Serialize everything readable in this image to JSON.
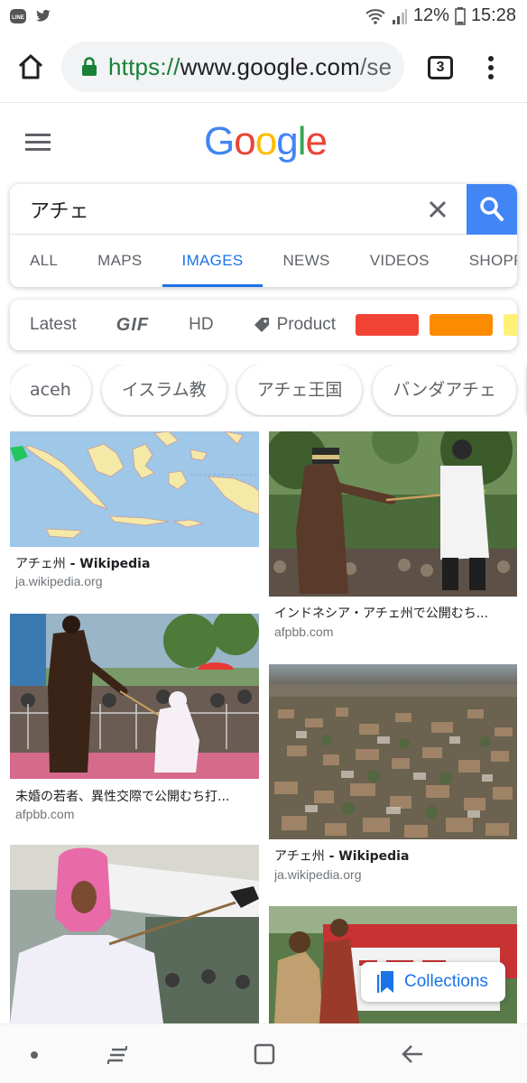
{
  "status_bar": {
    "left_icons": [
      "line-icon",
      "twitter-icon"
    ],
    "right_icons": [
      "wifi-icon",
      "signal-icon",
      "battery-icon"
    ],
    "battery": "12%",
    "time": "15:28"
  },
  "browser": {
    "url_scheme": "https://",
    "url_host": "www.google.com",
    "url_rest": "/se",
    "tab_count": "3",
    "icons": [
      "home-icon",
      "lock-icon",
      "more-vert-icon"
    ]
  },
  "google": {
    "logo": "Google",
    "icons": [
      "menu-icon"
    ]
  },
  "search": {
    "query": "アチェ",
    "icons": [
      "close-icon",
      "search-icon"
    ],
    "tabs": [
      {
        "label": "ALL",
        "active": false
      },
      {
        "label": "MAPS",
        "active": false
      },
      {
        "label": "IMAGES",
        "active": true
      },
      {
        "label": "NEWS",
        "active": false
      },
      {
        "label": "VIDEOS",
        "active": false
      },
      {
        "label": "SHOPPI",
        "active": false
      }
    ]
  },
  "filters": {
    "labels": [
      "Latest",
      "GIF",
      "HD",
      "Product"
    ],
    "icons": [
      "tag-icon"
    ],
    "colors": [
      "#f04336",
      "#fb8c00",
      "#fff176"
    ]
  },
  "chips": [
    "aceh",
    "イスラム教",
    "アチェ王国",
    "バンダアチェ"
  ],
  "results": [
    {
      "title_main": "アチェ州",
      "title_suffix": " - Wikipedia",
      "source": "ja.wikipedia.org"
    },
    {
      "title_main": "インドネシア・アチェ州で公開むち...",
      "title_suffix": "",
      "source": "afpbb.com"
    },
    {
      "title_main": "未婚の若者、異性交際で公開むち打...",
      "title_suffix": "",
      "source": "afpbb.com"
    },
    {
      "title_main": "アチェ州",
      "title_suffix": " - Wikipedia",
      "source": "ja.wikipedia.org"
    }
  ],
  "collections": {
    "label": "Collections",
    "icon": "bookmark-icon"
  },
  "nav_bar": {
    "icons": [
      "dot-icon",
      "recent-apps-icon",
      "home-square-icon",
      "back-icon"
    ]
  }
}
